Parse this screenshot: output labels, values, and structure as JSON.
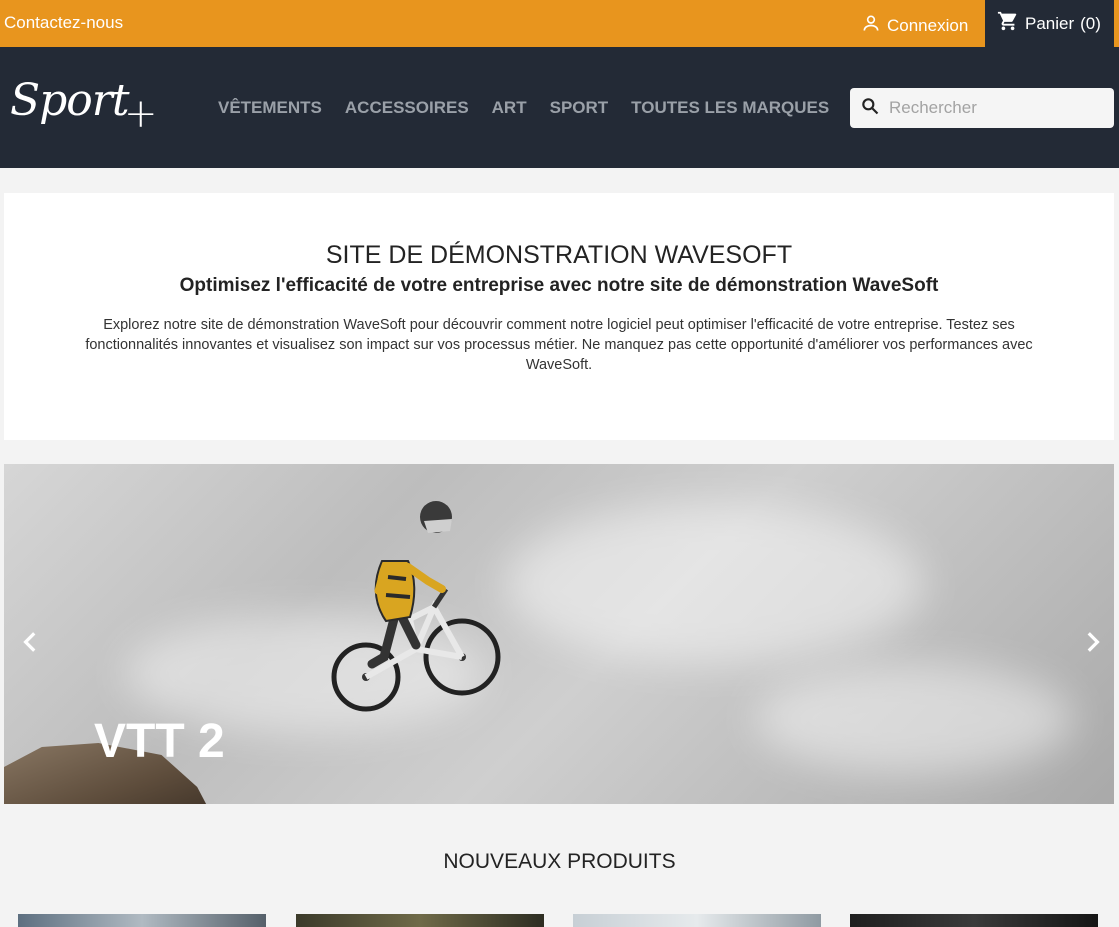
{
  "topbar": {
    "contact_label": "Contactez-nous",
    "login_label": "Connexion",
    "cart_label": "Panier",
    "cart_count": "(0)",
    "accent_color": "#e8951e"
  },
  "header": {
    "logo_text": "Sport",
    "logo_plus": "+",
    "nav": [
      "VÊTEMENTS",
      "ACCESSOIRES",
      "ART",
      "SPORT",
      "TOUTES LES MARQUES"
    ],
    "search_placeholder": "Rechercher",
    "background_color": "#232a36"
  },
  "intro": {
    "title": "SITE DE DÉMONSTRATION WAVESOFT",
    "subtitle": "Optimisez l'efficacité de votre entreprise avec notre site de démonstration WaveSoft",
    "body": "Explorez notre site de démonstration WaveSoft pour découvrir comment notre logiciel peut optimiser l'efficacité de votre entreprise. Testez ses fonctionnalités innovantes et visualisez son impact sur vos processus métier. Ne manquez pas cette opportunité d'améliorer vos performances avec WaveSoft."
  },
  "slider": {
    "slide_title": "VTT 2",
    "prev_icon": "chevron-left-icon",
    "next_icon": "chevron-right-icon"
  },
  "new_products": {
    "title": "NOUVEAUX PRODUITS"
  }
}
